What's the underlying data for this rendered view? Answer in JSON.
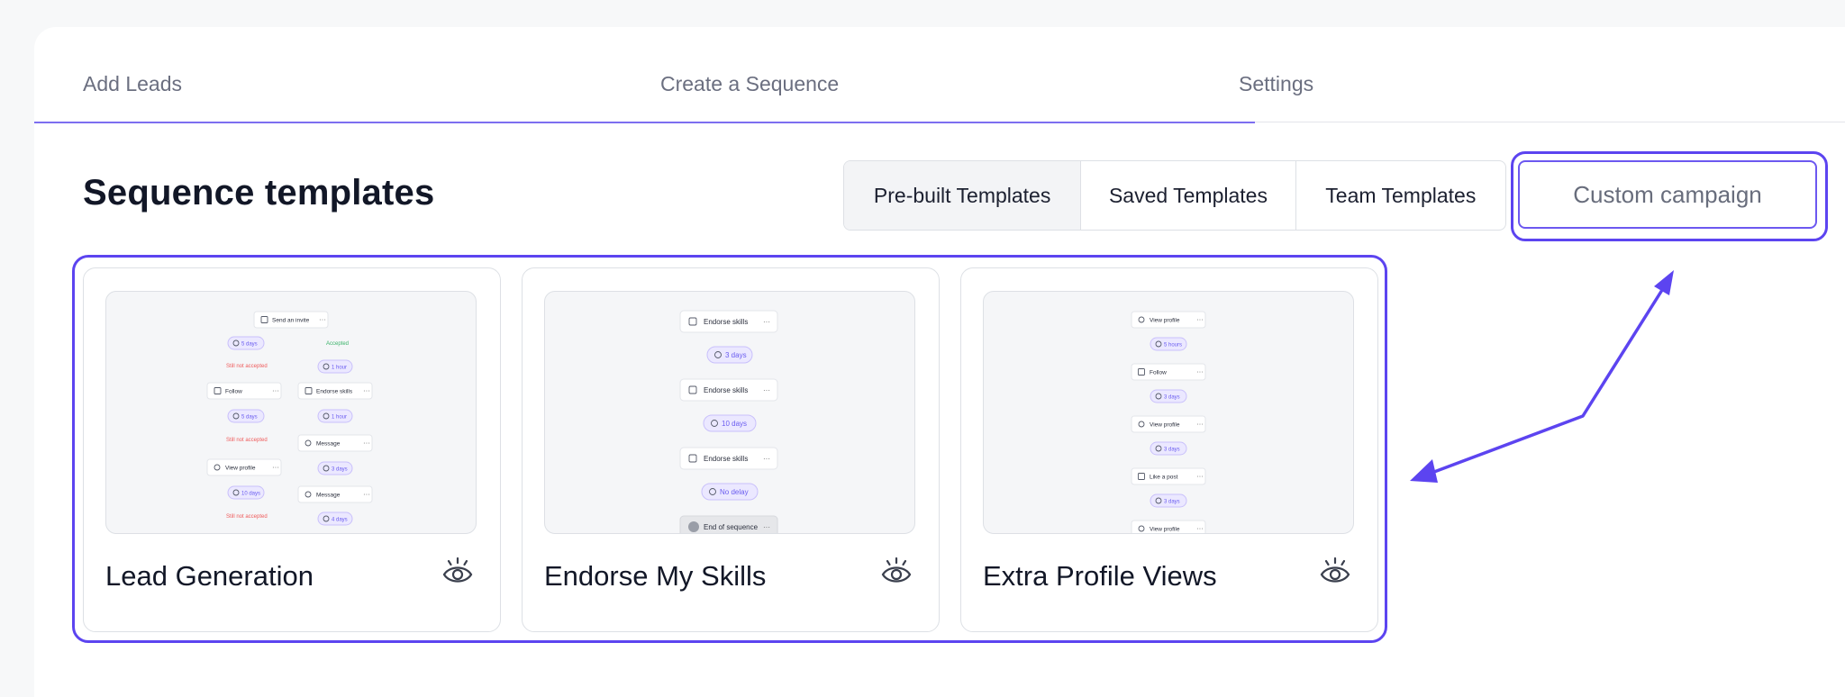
{
  "steps": [
    {
      "label": "Add Leads"
    },
    {
      "label": "Create a Sequence"
    },
    {
      "label": "Settings"
    }
  ],
  "page_title": "Sequence templates",
  "template_tabs": [
    {
      "label": "Pre-built Templates",
      "selected": true
    },
    {
      "label": "Saved Templates",
      "selected": false
    },
    {
      "label": "Team Templates",
      "selected": false
    }
  ],
  "custom_campaign_label": "Custom campaign",
  "cards": [
    {
      "name": "Lead Generation",
      "preview": {
        "top": "Send an invite",
        "left": [
          "5 days",
          "Still not accepted",
          "Follow",
          "5 days",
          "Still not accepted",
          "View profile",
          "10 days",
          "Still not accepted"
        ],
        "right": [
          "Accepted",
          "1 hour",
          "Endorse skills",
          "1 hour",
          "Message",
          "3 days",
          "Message",
          "4 days"
        ]
      }
    },
    {
      "name": "Endorse My Skills",
      "preview": [
        "Endorse skills",
        "3 days",
        "Endorse skills",
        "10 days",
        "Endorse skills",
        "No delay",
        "End of sequence"
      ]
    },
    {
      "name": "Extra Profile Views",
      "preview": [
        "View profile",
        "5 hours",
        "Follow",
        "3 days",
        "View profile",
        "3 days",
        "Like a post",
        "3 days",
        "View profile"
      ]
    }
  ],
  "colors": {
    "accent": "#5c44f0",
    "step_active_line": "#7c6ef0",
    "text_primary": "#121727",
    "text_muted": "#6b6f80"
  }
}
